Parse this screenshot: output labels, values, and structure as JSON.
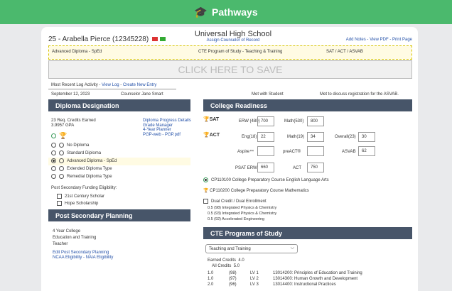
{
  "app": {
    "title": "Pathways"
  },
  "header": {
    "student": "25 - Arabella Pierce (12345228)",
    "school": "Universal High School",
    "assign": "Assign Counselor of Record",
    "links": "Add Notes - View PDF - Print Page"
  },
  "info_boxes": [
    "Advanced Diploma - SpEd",
    "CTE Program of Study - Teaching & Training",
    "SAT / ACT / ASVAB"
  ],
  "save": "CLICK HERE TO SAVE",
  "log": {
    "label": "Most Recent Log Activity",
    "view": "View Log",
    "create": "Create New Entry",
    "date": "September 12, 2023",
    "counselor": "Counselor Jane Smart",
    "met": "Met with Student",
    "note": "Met to discuss registration for the ASVAB."
  },
  "diploma": {
    "title": "Diploma Designation",
    "credits": "23 Req. Credits Earned",
    "gpa": "3.9957 GPA",
    "links": [
      "Diploma Progress Details",
      "Grade Manager",
      "4-Year Planner",
      "PGP-web - PGP.pdf"
    ],
    "options": [
      "No Diploma",
      "Standard Diploma",
      "Advanced Diploma - SpEd",
      "Extended Diploma Type",
      "Remedial Diploma Type"
    ],
    "funding_label": "Post Secondary Funding Eligibility:",
    "funding": [
      "21st Century Scholar",
      "Hope Scholarship"
    ]
  },
  "planning": {
    "title": "Post Secondary Planning",
    "items": [
      "4 Year College",
      "Education and Training",
      "Teacher"
    ],
    "links": [
      "Edit Post Secondary Planning",
      "NCAA Eligibility - NAIA Eligibility"
    ]
  },
  "college": {
    "title": "College Readiness",
    "sat": "SAT",
    "act": "ACT",
    "erw_label": "ERW (480)",
    "erw": "700",
    "sat_math_label": "Math(530)",
    "sat_math": "800",
    "eng_label": "Eng(18)",
    "eng": "22",
    "act_math_label": "Math(19)",
    "act_math": "34",
    "overall_label": "Overall(23)",
    "overall": "30",
    "aspire_label": "Aspire™",
    "preact_label": "preACT®",
    "asvab_label": "ASVAB",
    "asvab": "62",
    "psat_label": "PSAT ERW",
    "psat": "660",
    "act2_label": "ACT",
    "act2": "750",
    "courses": [
      "CP110100 College Preparatory Course English Language Arts",
      "CP110200 College Preparatory Course Mathematics"
    ],
    "dual_label": "Dual Credit / Dual Enrollment",
    "dual": [
      "0.5 (98) Integrated Physics & Chemistry",
      "0.5 (93) Integrated Physics & Chemistry",
      "0.5 (92) Accelerated Engineering"
    ]
  },
  "cte": {
    "title": "CTE Programs of Study",
    "select": "Teaching and Training",
    "earned_label": "Earned Credits",
    "earned": "4.0",
    "all_label": "All Credits",
    "all": "5.0",
    "rows": [
      {
        "credit": "1.0",
        "grade": "(98)",
        "lv": "LV 1",
        "course": "13014200: Principles of Education and Training"
      },
      {
        "credit": "1.0",
        "grade": "(97)",
        "lv": "LV 2",
        "course": "13014300: Human Growth and Development"
      },
      {
        "credit": "2.0",
        "grade": "(96)",
        "lv": "LV 3",
        "course": "13014400: Instructional Practices"
      }
    ]
  }
}
